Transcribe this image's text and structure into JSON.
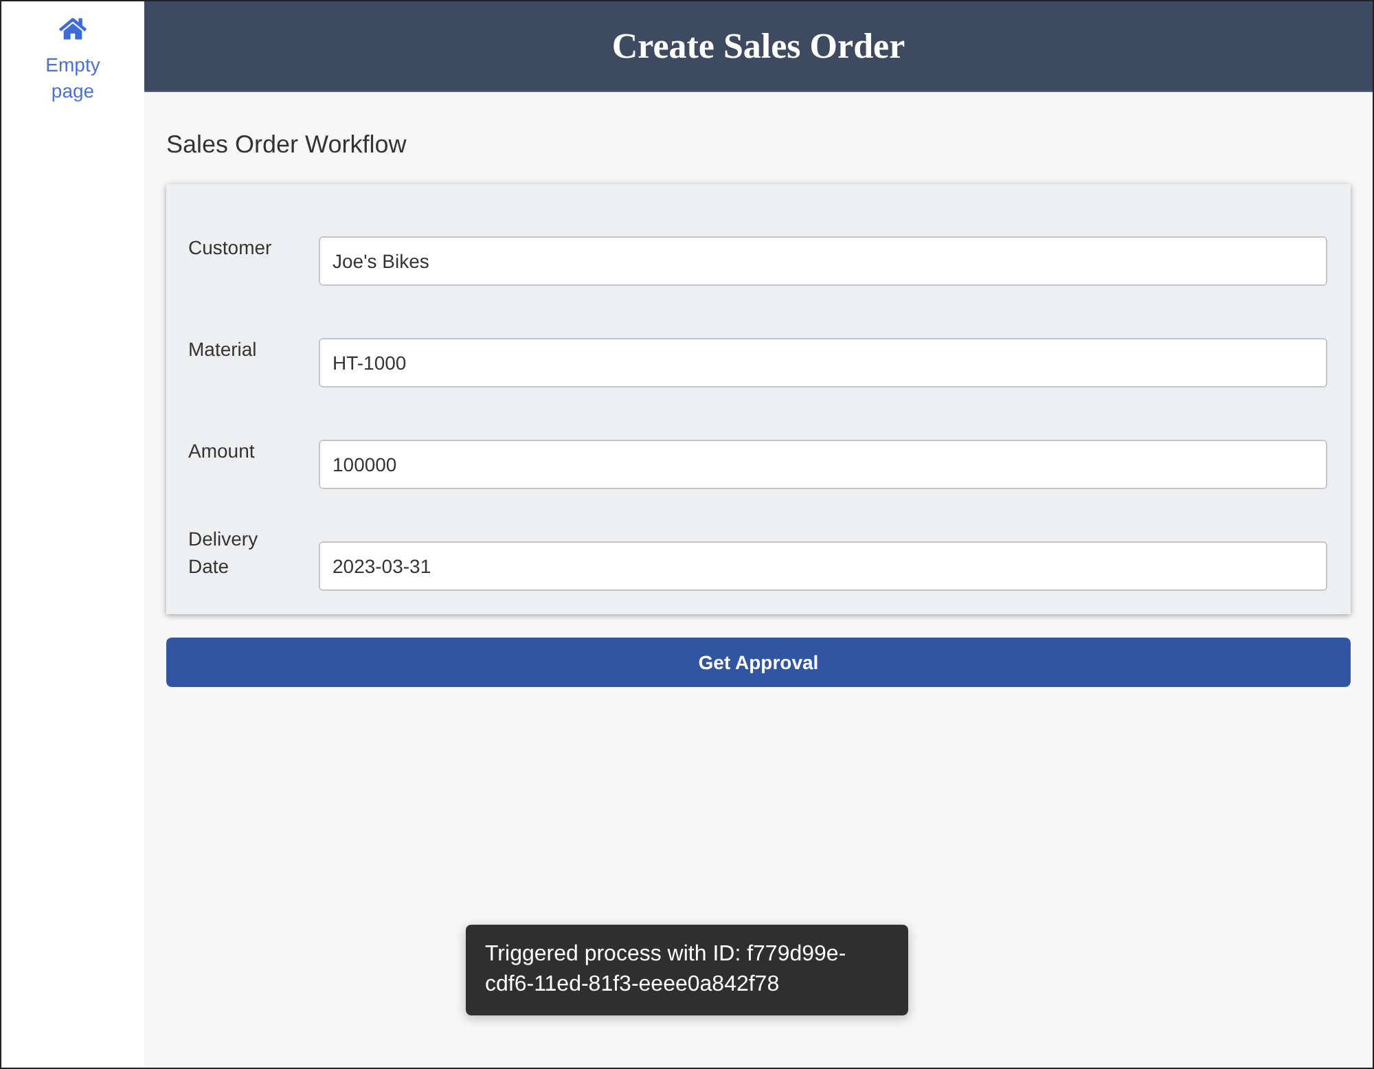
{
  "sidebar": {
    "items": [
      {
        "label": "Empty page"
      }
    ]
  },
  "header": {
    "title": "Create Sales Order"
  },
  "section": {
    "title": "Sales Order Workflow"
  },
  "form": {
    "fields": [
      {
        "label": "Customer",
        "value": "Joe's Bikes"
      },
      {
        "label": "Material",
        "value": "HT-1000"
      },
      {
        "label": "Amount",
        "value": "100000"
      },
      {
        "label": "Delivery Date",
        "value": "2023-03-31"
      }
    ]
  },
  "button": {
    "label": "Get Approval"
  },
  "toast": {
    "message": "Triggered process with ID: f779d99e-cdf6-11ed-81f3-eeee0a842f78"
  }
}
